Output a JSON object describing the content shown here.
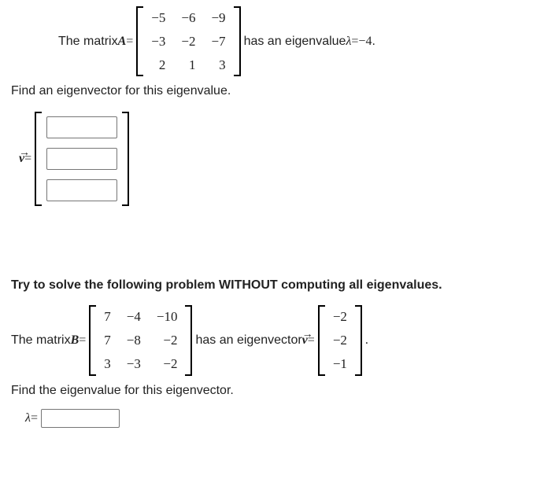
{
  "part1": {
    "pre": "The matrix ",
    "Aname": "A",
    "eq": " = ",
    "A": [
      [
        "−5",
        "−6",
        "−9"
      ],
      [
        "−3",
        "−2",
        "−7"
      ],
      [
        "2",
        "1",
        "3"
      ]
    ],
    "post1": " has an eigenvalue ",
    "lambda_sym": "λ",
    "eigen_eq": " = ",
    "eigen_val": "−4",
    "period": ".",
    "instr": "Find an eigenvector for this eigenvalue.",
    "vecname": "v",
    "veq": " = "
  },
  "part2": {
    "heading": "Try to solve the following problem WITHOUT computing all eigenvalues.",
    "pre": "The matrix ",
    "Bname": "B",
    "eq": " = ",
    "B": [
      [
        "7",
        "−4",
        "−10"
      ],
      [
        "7",
        "−8",
        "−2"
      ],
      [
        "3",
        "−3",
        "−2"
      ]
    ],
    "post1": " has an eigenvector ",
    "vecname": "v",
    "veq": " = ",
    "vvec": [
      [
        "−2"
      ],
      [
        "−2"
      ],
      [
        "−1"
      ]
    ],
    "period": ".",
    "instr": "Find the eigenvalue for this eigenvector.",
    "lambda_sym": "λ",
    "leq": " ="
  }
}
